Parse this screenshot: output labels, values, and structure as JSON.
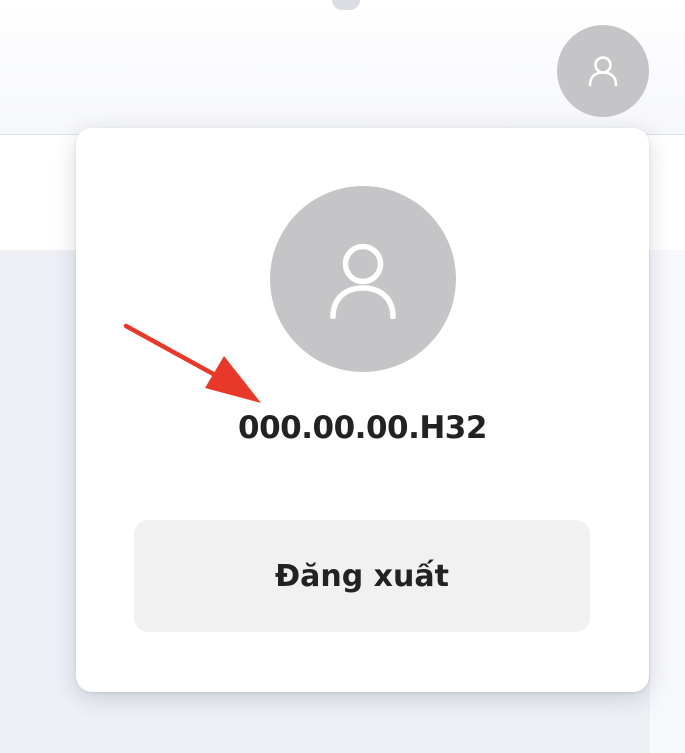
{
  "header": {
    "avatar_icon": "user-icon"
  },
  "popover": {
    "avatar_icon": "user-icon",
    "user_id": "000.00.00.H32",
    "logout_label": "Đăng xuất"
  },
  "annotation": {
    "arrow_color": "#e8382a"
  },
  "colors": {
    "avatar_bg": "#c5c5c8",
    "button_bg": "#f1f1f1",
    "text": "#222222"
  }
}
